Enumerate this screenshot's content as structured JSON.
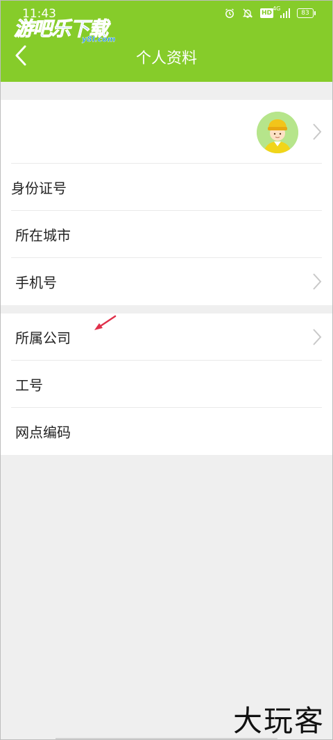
{
  "status_bar": {
    "time": "11:43",
    "network": "4G",
    "hd": "HD",
    "battery": "83"
  },
  "watermark_top": {
    "main": "游吧乐下载",
    "sub": "y8l.com"
  },
  "header": {
    "title": "个人资料",
    "background": "#86cc2a"
  },
  "profile": {
    "rows": [
      {
        "label": "身份证号"
      },
      {
        "label": "所在城市"
      },
      {
        "label": "手机号"
      }
    ]
  },
  "company": {
    "rows": [
      {
        "label": "所属公司"
      },
      {
        "label": "工号"
      },
      {
        "label": "网点编码"
      }
    ]
  },
  "watermark_bottom": {
    "text": "大玩客"
  },
  "icons": {
    "back": "chevron-left-icon",
    "chevron": "chevron-right-icon",
    "avatar": "courier-avatar",
    "annotation": "red-arrow-icon"
  },
  "colors": {
    "accent": "#86cc2a",
    "annotation": "#e0304a"
  }
}
